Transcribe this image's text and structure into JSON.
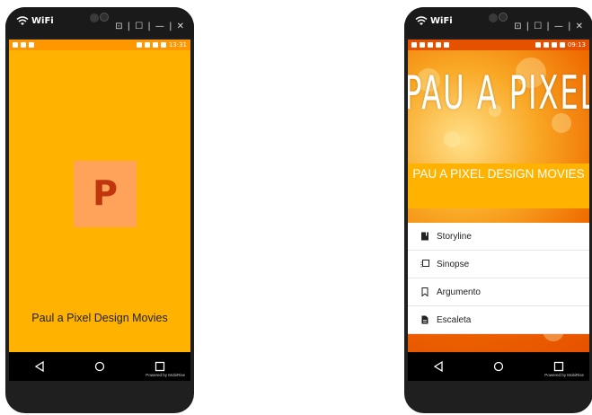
{
  "left_phone": {
    "wifi_label": "WiFi",
    "window_controls": "⊡ | ☐ | — | ✕",
    "status_time": "13:31",
    "logo_letter": "P",
    "app_title": "Paul a Pixel Design Movies",
    "powered_by": "Powered by MobiRise"
  },
  "right_phone": {
    "wifi_label": "WiFi",
    "window_controls": "⊡ | ☐ | — | ✕",
    "status_time": "09:13",
    "banner_text": "PAU A PIXEL",
    "header_title": "PAU A PIXEL DESIGN MOVIES",
    "menu": [
      {
        "label": "Storyline",
        "icon": "book-icon"
      },
      {
        "label": "Sinopse",
        "icon": "copy-icon"
      },
      {
        "label": "Argumento",
        "icon": "bookmark-icon"
      },
      {
        "label": "Escaleta",
        "icon": "document-icon"
      }
    ],
    "powered_by": "Powered by MobiRise"
  },
  "colors": {
    "accent": "#ffb300",
    "status": "#ff9800",
    "logo_bg": "#ffa35a",
    "logo_letter": "#bf360c"
  }
}
